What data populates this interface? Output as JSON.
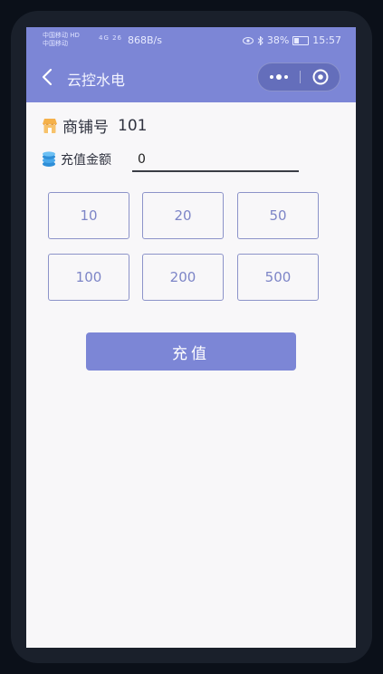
{
  "statusbar": {
    "carrier1": "中国移动 HD",
    "carrier2": "中国移动",
    "network": "4G 26",
    "speed": "868B/s",
    "battery": "38%",
    "time": "15:57",
    "battery_level": 0.38
  },
  "navbar": {
    "title": "云控水电",
    "more_icon": "•••"
  },
  "shop": {
    "label": "商铺号",
    "number": "101"
  },
  "amount": {
    "label": "充值金额",
    "value": "0"
  },
  "presets": [
    "10",
    "20",
    "50",
    "100",
    "200",
    "500"
  ],
  "recharge_button": "充值",
  "colors": {
    "accent": "#7c86d6",
    "button_border": "#8c93c9",
    "button_text": "#7d85c7"
  }
}
